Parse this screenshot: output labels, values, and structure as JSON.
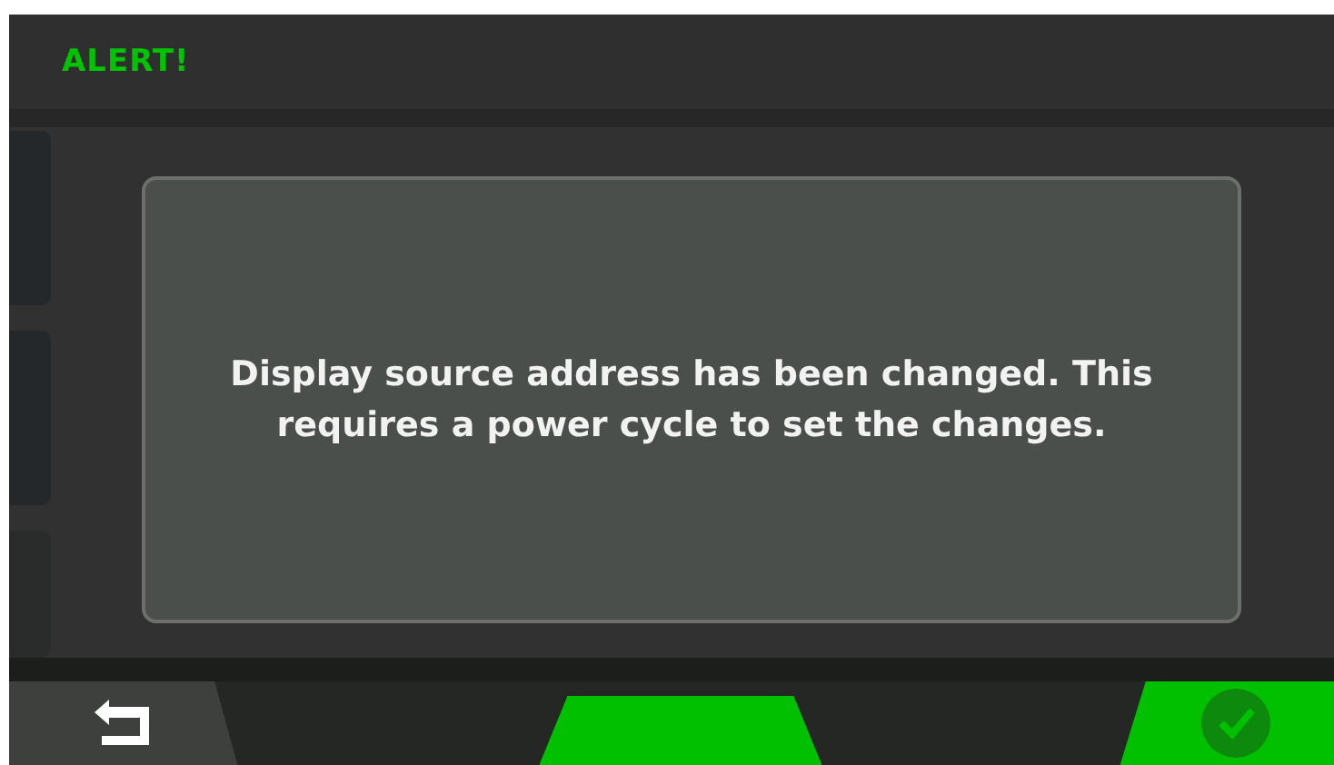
{
  "header": {
    "title": "ALERT!"
  },
  "dialog": {
    "message": "Display source address has been changed. This requires a power cycle to set the changes."
  },
  "footer_buttons": [
    {
      "kind": "back"
    },
    {
      "kind": "blank"
    },
    {
      "kind": "confirm"
    }
  ]
}
